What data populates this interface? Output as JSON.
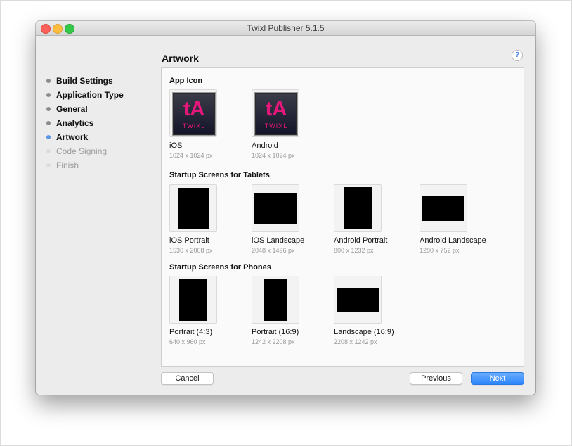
{
  "window": {
    "title": "Twixl Publisher 5.1.5"
  },
  "page": {
    "heading": "Artwork",
    "help_label": "?"
  },
  "sidebar": {
    "steps": [
      {
        "label": "Build Settings",
        "state": "done"
      },
      {
        "label": "Application Type",
        "state": "done"
      },
      {
        "label": "General",
        "state": "done"
      },
      {
        "label": "Analytics",
        "state": "done"
      },
      {
        "label": "Artwork",
        "state": "current"
      },
      {
        "label": "Code Signing",
        "state": "todo"
      },
      {
        "label": "Finish",
        "state": "todo"
      }
    ]
  },
  "sections": {
    "app_icon": {
      "title": "App Icon",
      "icon_text": "tA",
      "icon_subtext": "TWIXL",
      "items": [
        {
          "name": "iOS",
          "size": "1024 x 1024 px"
        },
        {
          "name": "Android",
          "size": "1024 x 1024 px"
        }
      ]
    },
    "tablets": {
      "title": "Startup Screens for Tablets",
      "items": [
        {
          "name": "iOS Portrait",
          "size": "1536 x 2008 px"
        },
        {
          "name": "iOS Landscape",
          "size": "2048 x 1496 px"
        },
        {
          "name": "Android Portrait",
          "size": "800 x 1232 px"
        },
        {
          "name": "Android Landscape",
          "size": "1280 x 752 px"
        }
      ]
    },
    "phones": {
      "title": "Startup Screens for Phones",
      "items": [
        {
          "name": "Portrait (4:3)",
          "size": "640 x 960 px"
        },
        {
          "name": "Portrait (16:9)",
          "size": "1242 x 2208 px"
        },
        {
          "name": "Landscape (16:9)",
          "size": "2208 x 1242 px"
        }
      ]
    }
  },
  "footer": {
    "cancel": "Cancel",
    "previous": "Previous",
    "next": "Next"
  },
  "colors": {
    "accent": "#2d86fb",
    "brand": "#e6177b",
    "current_step": "#5a96e6"
  }
}
